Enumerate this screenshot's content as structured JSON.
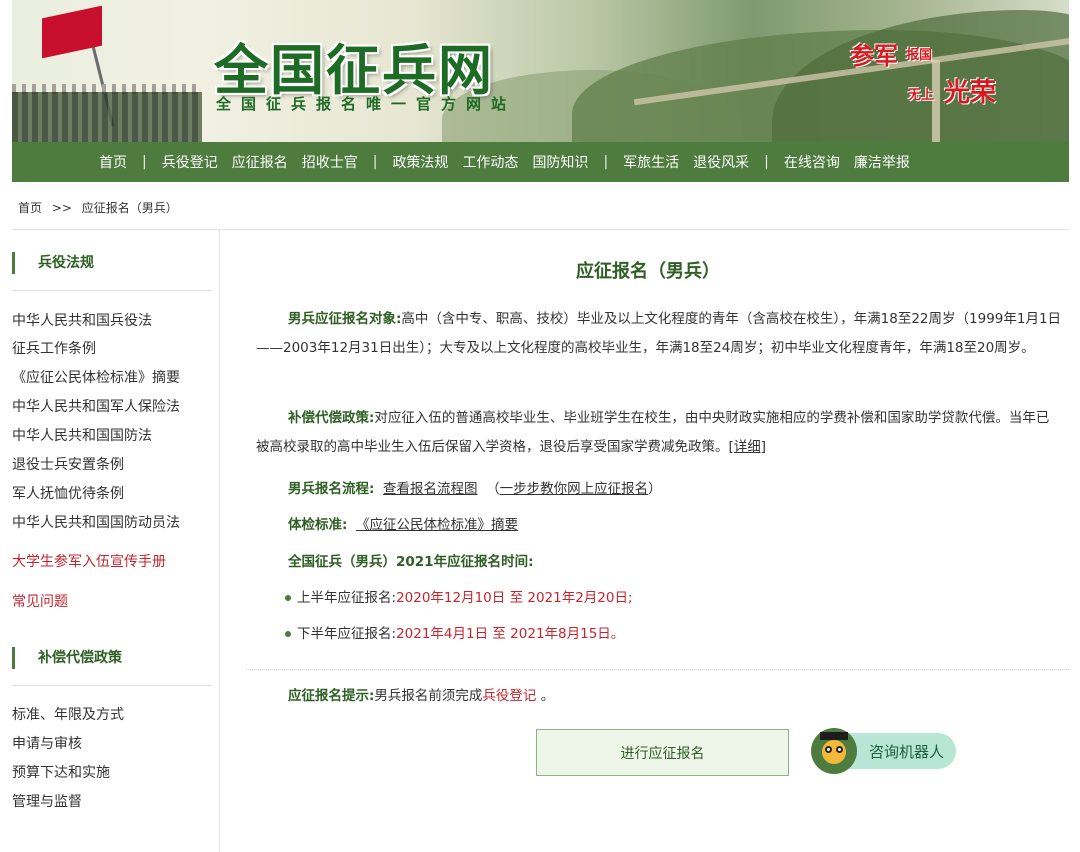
{
  "header": {
    "site_title": "全国征兵网",
    "site_subtitle": "全国征兵报名唯一官方网站",
    "slogan": {
      "a": "参军",
      "b": "报国",
      "c": "无上",
      "d": "光荣"
    }
  },
  "nav": {
    "items": [
      "首页",
      "兵役登记",
      "应征报名",
      "招收士官",
      "政策法规",
      "工作动态",
      "国防知识",
      "军旅生活",
      "退役风采",
      "在线咨询",
      "廉洁举报"
    ],
    "separator": "|"
  },
  "breadcrumb": {
    "home": "首页",
    "sep": ">>",
    "current": "应征报名（男兵）"
  },
  "sidebar": {
    "section1_title": "兵役法规",
    "section1_items": [
      "中华人民共和国兵役法",
      "征兵工作条例",
      "《应征公民体检标准》摘要",
      "中华人民共和国军人保险法",
      "中华人民共和国国防法",
      "退役士兵安置条例",
      "军人抚恤优待条例",
      "中华人民共和国国防动员法"
    ],
    "red_link1": "大学生参军入伍宣传手册",
    "red_link2": "常见问题",
    "section2_title": "补偿代偿政策",
    "section2_items": [
      "标准、年限及方式",
      "申请与审核",
      "预算下达和实施",
      "管理与监督"
    ]
  },
  "main": {
    "title": "应征报名（男兵）",
    "target_label": "男兵应征报名对象:",
    "target_text": "高中（含中专、职高、技校）毕业及以上文化程度的青年（含高校在校生），年满18至22周岁（1999年1月1日——2003年12月31日出生）；大专及以上文化程度的高校毕业生，年满18至24周岁；初中毕业文化程度青年，年满18至20周岁。",
    "comp_label": "补偿代偿政策:",
    "comp_text": "对应征入伍的普通高校毕业生、毕业班学生在校生，由中央财政实施相应的学费补偿和国家助学贷款代偿。当年已被高校录取的高中毕业生入伍后保留入学资格，退役后享受国家学费减免政策。",
    "comp_link": "[详细]",
    "flow_label": "男兵报名流程:",
    "flow_link1": "查看报名流程图",
    "flow_link2": "一步步教你网上应征报名",
    "exam_label": "体检标准:",
    "exam_link": "《应征公民体检标准》摘要",
    "time_title": "全国征兵（男兵）2021年应征报名时间:",
    "time1_label": "上半年应征报名:",
    "time1_value": "2020年12月10日 至 2021年2月20日;",
    "time2_label": "下半年应征报名:",
    "time2_value": "2021年4月1日 至 2021年8月15日。",
    "tip_label": "应征报名提示:",
    "tip_text": "男兵报名前须完成",
    "tip_link": "兵役登记",
    "tip_end": "。",
    "apply_button": "进行应征报名",
    "robot_label": "咨询机器人"
  },
  "colors": {
    "primary_green": "#4d7c3e",
    "title_green": "#2e5f24",
    "accent_red": "#c4262e",
    "robot_pill": "#b7e6d5"
  }
}
